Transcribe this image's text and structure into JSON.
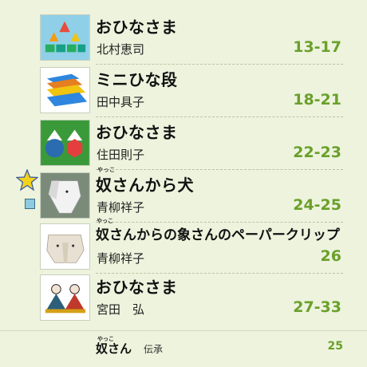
{
  "entries": [
    {
      "title": "おひなさま",
      "author": "北村恵司",
      "pages": "13-17"
    },
    {
      "title": "ミニひな段",
      "author": "田中具子",
      "pages": "18-21"
    },
    {
      "title": "おひなさま",
      "author": "住田則子",
      "pages": "22-23"
    },
    {
      "title": "奴さんから犬",
      "ruby": "やっこ",
      "author": "青柳祥子",
      "pages": "24-25"
    },
    {
      "title": "奴さんからの象さんのペーパークリップ",
      "ruby": "やっこ",
      "author": "青柳祥子",
      "pages": "26"
    },
    {
      "title": "おひなさま",
      "author": "宮田　弘",
      "pages": "27-33"
    }
  ],
  "footer": {
    "title": "奴さん",
    "ruby": "やっこ",
    "subtitle": "伝承",
    "page_number": "25"
  },
  "markers": {
    "star_color": "#f3d21c",
    "square_color": "#8ecae0"
  },
  "colors": {
    "page_numbers": "#6aa02a",
    "background": "#edf3dd"
  }
}
